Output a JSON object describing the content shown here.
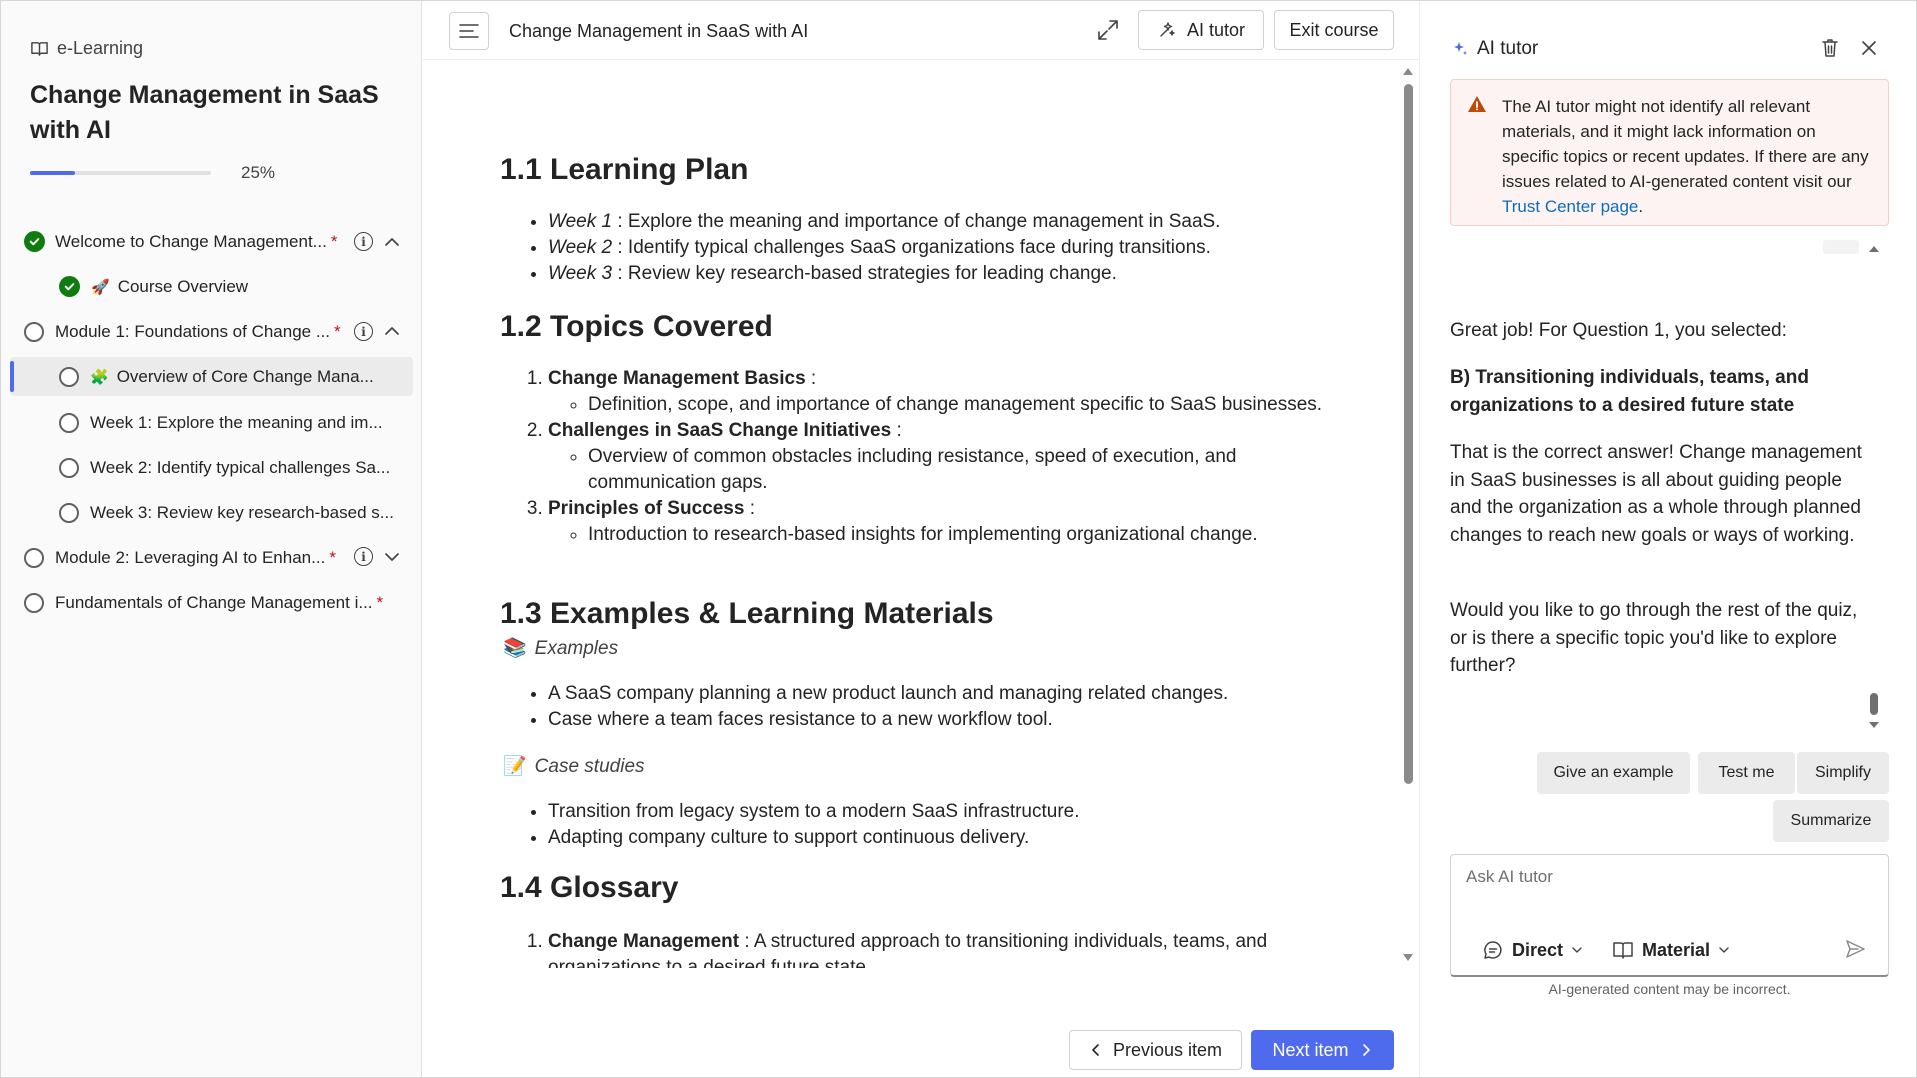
{
  "sidebar": {
    "brand": "e-Learning",
    "course_title": "Change Management in SaaS with AI",
    "progress": {
      "percent_label": "25%",
      "value": 0.25
    },
    "items": [
      {
        "label": "Welcome to Change Management...",
        "status": "complete",
        "required": "*",
        "expanded": true
      },
      {
        "emoji": "🚀",
        "label": "Course Overview",
        "status": "complete"
      },
      {
        "label": "Module 1: Foundations of Change ...",
        "status": "incomplete",
        "required": "*",
        "expanded": true
      },
      {
        "emoji": "🧩",
        "label": "Overview of Core Change Mana...",
        "status": "incomplete",
        "selected": true
      },
      {
        "label": "Week 1: Explore the meaning and im...",
        "status": "incomplete"
      },
      {
        "label": "Week 2: Identify typical challenges Sa...",
        "status": "incomplete"
      },
      {
        "label": "Week 3: Review key research-based s...",
        "status": "incomplete"
      },
      {
        "label": "Module 2: Leveraging AI to Enhan...",
        "status": "incomplete",
        "required": "*",
        "expanded": false
      },
      {
        "label": "Fundamentals of Change Management i...",
        "status": "incomplete",
        "required": "*"
      }
    ]
  },
  "header": {
    "title": "Change Management in SaaS with AI",
    "ai_tutor_label": "AI tutor",
    "exit_label": "Exit course"
  },
  "content": {
    "s1_title": "1.1 Learning Plan",
    "s1_items": [
      {
        "label": "Week 1",
        "text": " : Explore the meaning and importance of change management in SaaS."
      },
      {
        "label": "Week 2",
        "text": " : Identify typical challenges SaaS organizations face during transitions."
      },
      {
        "label": "Week 3",
        "text": " : Review key research-based strategies for leading change."
      }
    ],
    "s2_title": "1.2 Topics Covered",
    "s2_items": [
      {
        "label": "Change Management Basics",
        "sep": " :",
        "sub": "Definition, scope, and importance of change management specific to SaaS businesses."
      },
      {
        "label": "Challenges in SaaS Change Initiatives",
        "sep": " :",
        "sub": "Overview of common obstacles including resistance, speed of execution, and communication gaps."
      },
      {
        "label": "Principles of Success",
        "sep": " :",
        "sub": "Introduction to research-based insights for implementing organizational change."
      }
    ],
    "s3_title": "1.3 Examples & Learning Materials",
    "examples_icon": "📚",
    "examples_label": "Examples",
    "examples": [
      "A SaaS company planning a new product launch and managing related changes.",
      "Case where a team faces resistance to a new workflow tool."
    ],
    "cases_icon": "📝",
    "cases_label": "Case studies",
    "cases": [
      "Transition from legacy system to a modern SaaS infrastructure.",
      "Adapting company culture to support continuous delivery."
    ],
    "s4_title": "1.4 Glossary",
    "glossary": [
      {
        "label": "Change Management",
        "text": " : A structured approach to transitioning individuals, teams, and organizations to a desired future state."
      }
    ]
  },
  "footer": {
    "prev_label": "Previous item",
    "next_label": "Next item"
  },
  "ai_panel": {
    "title": "AI tutor",
    "warning_text": "The AI tutor might not identify all relevant materials, and it might lack information on specific topics or recent updates. If there are any issues related to AI-generated content visit our ",
    "warning_link": "Trust Center page",
    "warning_end": ".",
    "msg1": "Great job! For Question 1, you selected:",
    "msg2": "B) Transitioning individuals, teams, and organizations to a desired future state",
    "msg3": "That is the correct answer! Change management in SaaS businesses is all about guiding people and the organization as a whole through planned changes to reach new goals or ways of working.",
    "msg4": "Would you like to go through the rest of the quiz, or is there a specific topic you'd like to explore further?",
    "chips": [
      "Give an example",
      "Test me",
      "Simplify",
      "Summarize"
    ],
    "ask_placeholder": "Ask AI tutor",
    "mode_label": "Direct",
    "source_label": "Material",
    "disclaimer": "AI-generated content may be incorrect."
  }
}
